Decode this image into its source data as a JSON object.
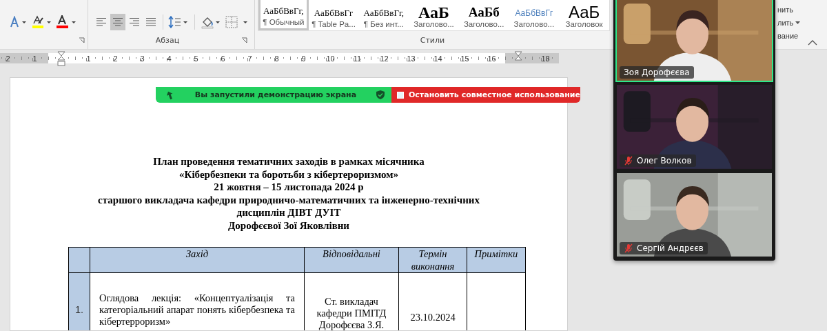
{
  "ribbon": {
    "text_tools": [
      {
        "kind": "effects"
      },
      {
        "kind": "highlight",
        "color": "#ffff00"
      },
      {
        "kind": "font-color",
        "color": "#ff0000"
      }
    ],
    "alignment": [
      {
        "kind": "left",
        "selected": false
      },
      {
        "kind": "center",
        "selected": true
      },
      {
        "kind": "right",
        "selected": false
      },
      {
        "kind": "justify",
        "selected": false
      }
    ],
    "paragraph_group": "Абзац",
    "styles": [
      {
        "sample": "АаБбВвГг,",
        "name": "¶ Обычный",
        "kind": "normal",
        "selected": true
      },
      {
        "sample": "АаБбВвГг",
        "name": "¶ Table Pa...",
        "kind": "normal",
        "selected": false
      },
      {
        "sample": "АаБбВвГг,",
        "name": "¶ Без инт...",
        "kind": "normal",
        "selected": false
      },
      {
        "sample": "АаБ",
        "name": "Заголово...",
        "kind": "heading1",
        "selected": false
      },
      {
        "sample": "АаБб",
        "name": "Заголово...",
        "kind": "heading2",
        "selected": false
      },
      {
        "sample": "АаБбВвГг",
        "name": "Заголово...",
        "kind": "subtle",
        "selected": false
      },
      {
        "sample": "АаБ",
        "name": "Заголовок",
        "kind": "title",
        "selected": false
      }
    ],
    "styles_group": "Стили",
    "edit_commands": [
      "нить",
      "лить",
      "вание"
    ]
  },
  "ruler": [
    {
      "kind": "number",
      "label": "2",
      "margin": true
    },
    {
      "kind": "number",
      "label": "1",
      "margin": true
    },
    {
      "kind": "indent",
      "margin": false
    },
    {
      "kind": "number",
      "label": "1",
      "margin": false
    },
    {
      "kind": "number",
      "label": "2",
      "margin": false
    },
    {
      "kind": "number",
      "label": "3",
      "margin": false
    },
    {
      "kind": "number",
      "label": "4",
      "margin": false
    },
    {
      "kind": "number",
      "label": "5",
      "margin": false
    },
    {
      "kind": "number",
      "label": "6",
      "margin": false
    },
    {
      "kind": "number",
      "label": "7",
      "margin": false
    },
    {
      "kind": "number",
      "label": "8",
      "margin": false
    },
    {
      "kind": "number",
      "label": "9",
      "margin": false
    },
    {
      "kind": "number",
      "label": "10",
      "margin": false
    },
    {
      "kind": "number",
      "label": "11",
      "margin": false
    },
    {
      "kind": "number",
      "label": "12",
      "margin": false
    },
    {
      "kind": "number",
      "label": "13",
      "margin": false
    },
    {
      "kind": "number",
      "label": "14",
      "margin": false
    },
    {
      "kind": "number",
      "label": "15",
      "margin": false
    },
    {
      "kind": "number",
      "label": "16",
      "margin": false
    },
    {
      "kind": "indent",
      "margin": true
    },
    {
      "kind": "number",
      "label": "18",
      "margin": true
    }
  ],
  "share_banner": {
    "status": "Вы запустили демонстрацию экрана",
    "stop_button": "Остановить совместное использование"
  },
  "document": {
    "heading": [
      "План проведення тематичних заходів в рамках місячника",
      "«Кібербезпеки та боротьби з кібертероризмом»",
      "21 жовтня – 15 листопада 2024 р",
      "старшого викладача кафедри природничо-математичних та інженерно-технічних",
      "дисциплін ДІВТ ДУІТ",
      "Дорофєєвої Зої Яковлівни"
    ],
    "table": {
      "columns": [
        "Захід",
        "Відповідальні",
        "Термін виконання",
        "Примітки"
      ],
      "rows": [
        {
          "number": "1.",
          "event": "Оглядова лекція: «Концептуалізація та категоріальний апарат понять кібербезпека та кібертерроризм»",
          "responsible": "Ст. викладач кафедри ПМІТД Дорофєєва З.Я.",
          "date": "23.10.2024"
        }
      ]
    }
  },
  "participants": [
    {
      "name": "Зоя Дорофєєва",
      "muted": false,
      "speaking": true,
      "kind": "picture"
    },
    {
      "name": "Олег Волков",
      "muted": true,
      "speaking": false,
      "kind": "picture"
    },
    {
      "name": "Сергій Андрєєв",
      "muted": true,
      "speaking": false,
      "kind": "picture"
    }
  ]
}
